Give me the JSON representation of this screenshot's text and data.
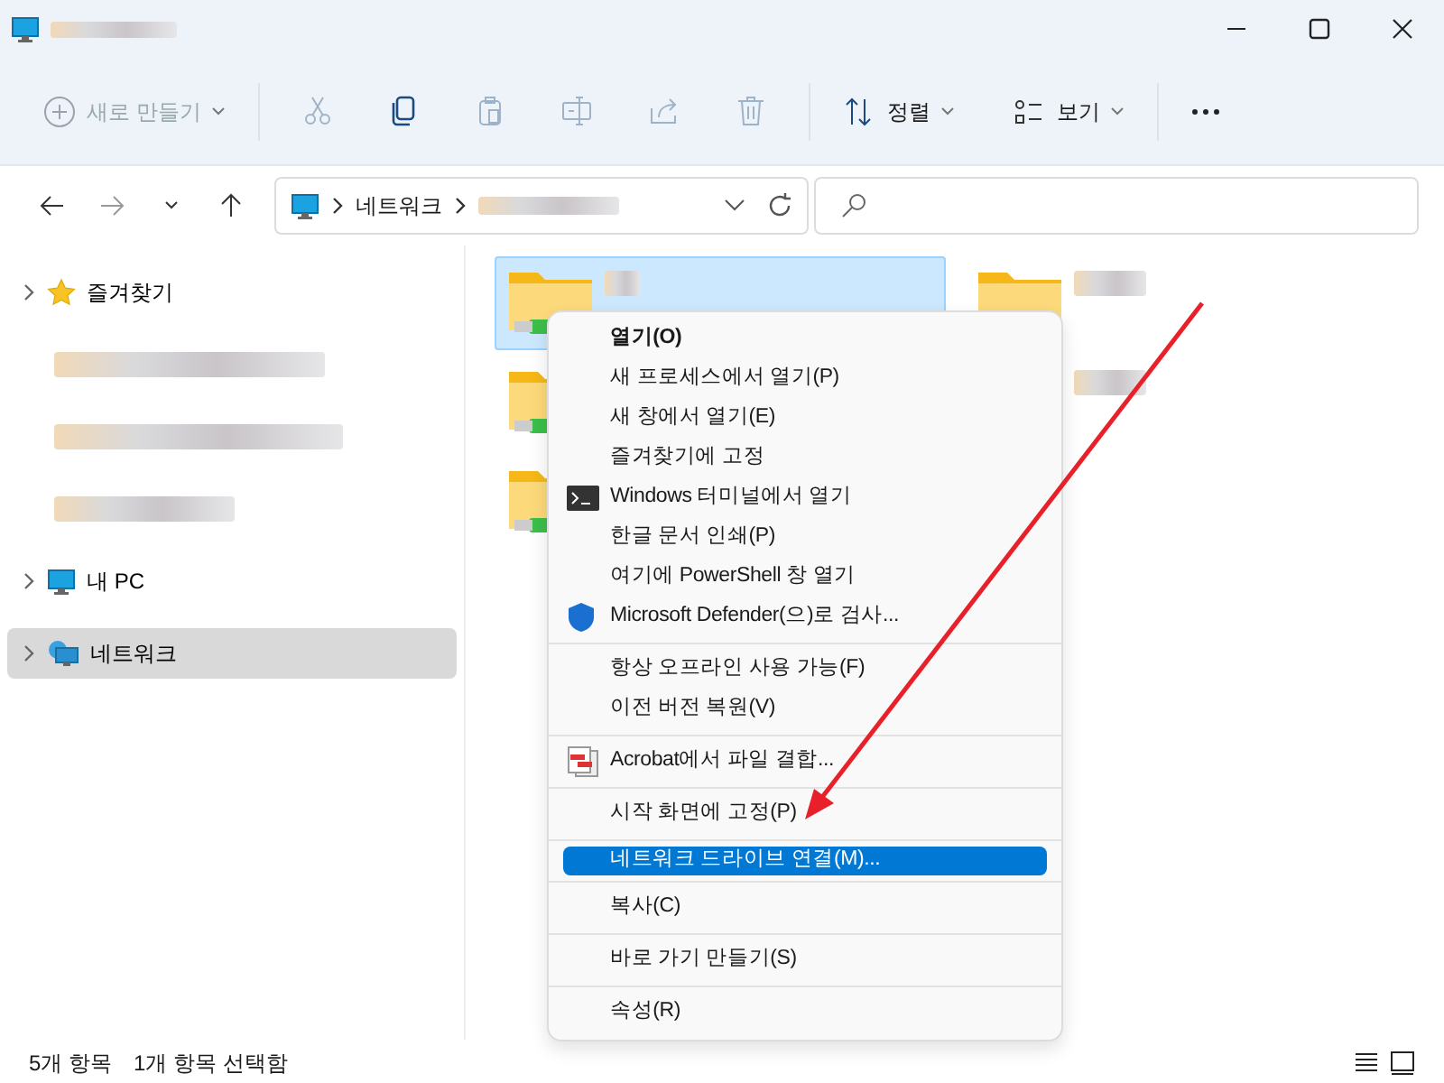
{
  "toolbar": {
    "new_button": {
      "label": "새로 만들기",
      "disabled": true
    },
    "tools": [
      {
        "kind": "cut",
        "disabled": true
      },
      {
        "kind": "copy",
        "disabled": false
      },
      {
        "kind": "paste",
        "disabled": true
      },
      {
        "kind": "rename",
        "disabled": true
      },
      {
        "kind": "share",
        "disabled": true
      },
      {
        "kind": "delete",
        "disabled": true
      }
    ],
    "sort_button": {
      "label": "정렬"
    },
    "view_button": {
      "label": "보기"
    }
  },
  "address_bar": {
    "crumbs": [
      "네트워크"
    ]
  },
  "sidebar": {
    "items": [
      {
        "kind": "star",
        "label": "즐겨찾기",
        "selected": false
      },
      {
        "kind": "redacted",
        "selected": false
      },
      {
        "kind": "redacted",
        "selected": false
      },
      {
        "kind": "redacted",
        "selected": false
      },
      {
        "kind": "pc",
        "label": "내 PC",
        "selected": false
      },
      {
        "kind": "network",
        "label": "네트워크",
        "selected": true
      }
    ]
  },
  "files": [
    {
      "selected": true
    },
    {
      "selected": false
    },
    {
      "selected": false
    },
    {
      "selected": false
    },
    {
      "selected": false
    }
  ],
  "context_menu": {
    "groups": [
      [
        {
          "label": "열기(O)",
          "kind": "plain",
          "bold": true,
          "selected": false
        },
        {
          "label": "새 프로세스에서 열기(P)",
          "kind": "plain",
          "bold": false,
          "selected": false
        },
        {
          "label": "새 창에서 열기(E)",
          "kind": "plain",
          "bold": false,
          "selected": false
        },
        {
          "label": "즐겨찾기에 고정",
          "kind": "plain",
          "bold": false,
          "selected": false
        },
        {
          "label": "Windows 터미널에서 열기",
          "kind": "terminal",
          "bold": false,
          "selected": false
        },
        {
          "label": "한글 문서 인쇄(P)",
          "kind": "plain",
          "bold": false,
          "selected": false
        },
        {
          "label": "여기에 PowerShell 창 열기",
          "kind": "plain",
          "bold": false,
          "selected": false
        },
        {
          "label": "Microsoft Defender(으)로 검사...",
          "kind": "shield",
          "bold": false,
          "selected": false
        }
      ],
      [
        {
          "label": "항상 오프라인 사용 가능(F)",
          "kind": "plain",
          "bold": false,
          "selected": false
        },
        {
          "label": "이전 버전 복원(V)",
          "kind": "plain",
          "bold": false,
          "selected": false
        }
      ],
      [
        {
          "label": "Acrobat에서 파일 결합...",
          "kind": "acrobat",
          "bold": false,
          "selected": false
        }
      ],
      [
        {
          "label": "시작 화면에 고정(P)",
          "kind": "plain",
          "bold": false,
          "selected": false
        }
      ],
      [
        {
          "label": "네트워크 드라이브 연결(M)...",
          "kind": "plain",
          "bold": false,
          "selected": true
        }
      ],
      [
        {
          "label": "복사(C)",
          "kind": "plain",
          "bold": false,
          "selected": false
        }
      ],
      [
        {
          "label": "바로 가기 만들기(S)",
          "kind": "plain",
          "bold": false,
          "selected": false
        }
      ],
      [
        {
          "label": "속성(R)",
          "kind": "plain",
          "bold": false,
          "selected": false
        }
      ]
    ]
  },
  "status_bar": {
    "item_count": "5개 항목",
    "selection": "1개 항목 선택함"
  }
}
